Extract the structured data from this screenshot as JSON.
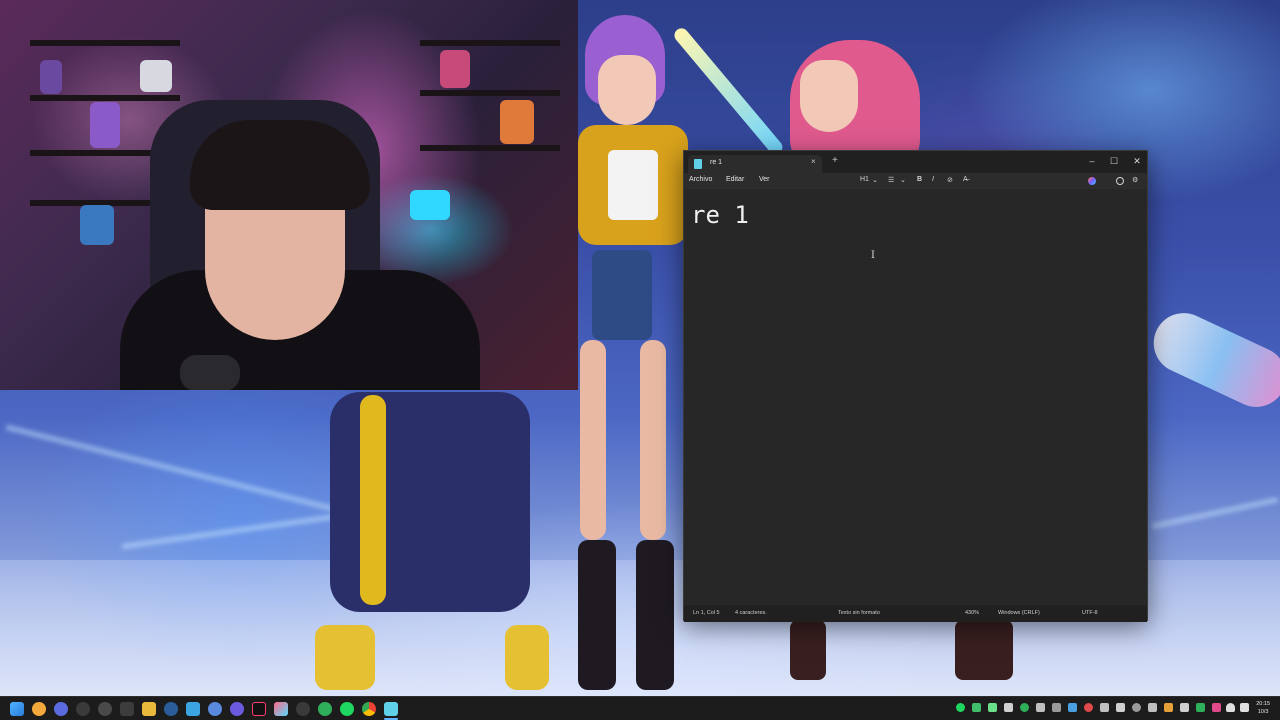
{
  "notepad": {
    "tab_title": "re 1",
    "tab_close": "×",
    "new_tab": "+",
    "window_buttons": {
      "minimize": "–",
      "maximize": "☐",
      "close": "✕"
    },
    "menu": {
      "file": "Archivo",
      "edit": "Editar",
      "view": "Ver"
    },
    "toolbar": {
      "heading": "H1",
      "heading_caret": "⌄",
      "list": "☰",
      "list_caret": "⌄",
      "bold": "B",
      "italic": "I",
      "link": "⊘",
      "clear_format": "A̶",
      "settings": "⚙"
    },
    "content": "re 1",
    "cursor_glyph": "I",
    "status": {
      "position": "Ln 1, Col 5",
      "characters": "4 caracteres.",
      "format": "Texto sin formato",
      "zoom": "430%",
      "line_endings": "Windows (CRLF)",
      "encoding": "UTF-8"
    }
  },
  "taskbar": {
    "clock_time": "20:15",
    "clock_date": "10/3",
    "apps": [
      "windows-start",
      "search",
      "app-v",
      "app-x",
      "app-arrow",
      "app-disc",
      "app-folder",
      "app-steam",
      "app-globe",
      "app-chat",
      "app-tiktok",
      "app-photos",
      "app-c",
      "app-spotify-like",
      "app-green",
      "app-spotify",
      "app-chrome",
      "app-notepad"
    ]
  },
  "colors": {
    "accent": "#5fb3ff",
    "notepad_bg": "#272727",
    "titlebar": "#202020",
    "taskbar": "#1c1c1c"
  }
}
